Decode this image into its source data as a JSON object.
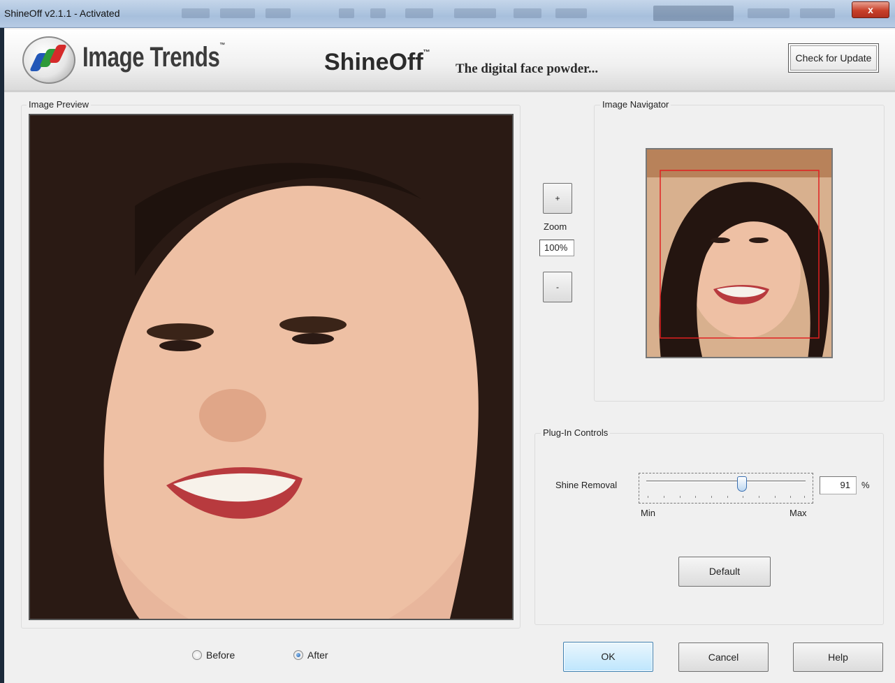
{
  "window": {
    "title": "ShineOff v2.1.1 - Activated",
    "close_glyph": "x"
  },
  "header": {
    "brand": "Image Trends",
    "trademark": "™",
    "product": "ShineOff",
    "product_trademark": "™",
    "tagline": "The digital face powder...",
    "check_update_label": "Check for Update",
    "check_update_underline": "U"
  },
  "preview": {
    "label": "Image Preview"
  },
  "zoom": {
    "plus_glyph": "+",
    "minus_glyph": "-",
    "label": "Zoom",
    "value": "100%"
  },
  "navigator": {
    "label": "Image Navigator"
  },
  "controls": {
    "label": "Plug-In Controls",
    "shine_removal_label": "Shine Removal",
    "shine_removal_value": "91",
    "shine_removal_fraction": 0.6,
    "unit": "%",
    "min_label": "Min",
    "max_label": "Max",
    "default_label": "Default"
  },
  "view_mode": {
    "before_label": "Before",
    "after_label": "After",
    "selected": "After"
  },
  "buttons": {
    "ok": "OK",
    "cancel": "Cancel",
    "help": "Help"
  },
  "colors": {
    "accent": "#3a6fb0",
    "nav_rect": "#e02020"
  }
}
